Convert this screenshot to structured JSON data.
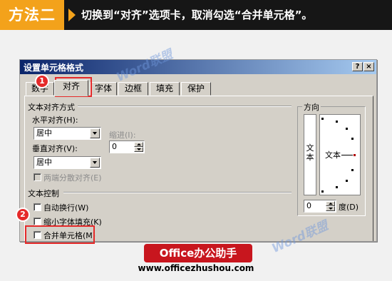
{
  "banner": {
    "tag": "方法二",
    "instruction": "切换到“对齐”选项卡，取消勾选“合并单元格”。"
  },
  "dialog": {
    "title": "设置单元格格式",
    "help_button": "?",
    "close_button": "×",
    "tabs": [
      {
        "label": "数字"
      },
      {
        "label": "对齐"
      },
      {
        "label": "字体"
      },
      {
        "label": "边框"
      },
      {
        "label": "填充"
      },
      {
        "label": "保护"
      }
    ],
    "active_tab": "对齐",
    "text_alignment": {
      "section_label": "文本对齐方式",
      "horizontal_label": "水平对齐(H):",
      "horizontal_value": "居中",
      "indent_label": "缩进(I):",
      "indent_value": "0",
      "vertical_label": "垂直对齐(V):",
      "vertical_value": "居中",
      "distributed_label": "两端分散对齐(E)"
    },
    "text_control": {
      "section_label": "文本控制",
      "wrap_label": "自动换行(W)",
      "shrink_label": "缩小字体填充(K)",
      "merge_label": "合并单元格(M)",
      "wrap_checked": false,
      "shrink_checked": false,
      "merge_checked": false
    },
    "orientation": {
      "section_label": "方向",
      "vertical_text": "文本",
      "horizontal_text": "文本",
      "degrees_value": "0",
      "degrees_unit": "度(D)"
    }
  },
  "annotations": {
    "badge_1": "1",
    "badge_2": "2",
    "highlight_color": "#e52a2a"
  },
  "watermarks": [
    "Word联盟",
    "Word联盟"
  ],
  "footer": {
    "brand": "Office办公助手",
    "url": "www.officezhushou.com"
  },
  "colors": {
    "banner_accent": "#f3a21b",
    "banner_bg": "#161616",
    "brand_red": "#c8161e",
    "dialog_face": "#d4d0c8"
  }
}
